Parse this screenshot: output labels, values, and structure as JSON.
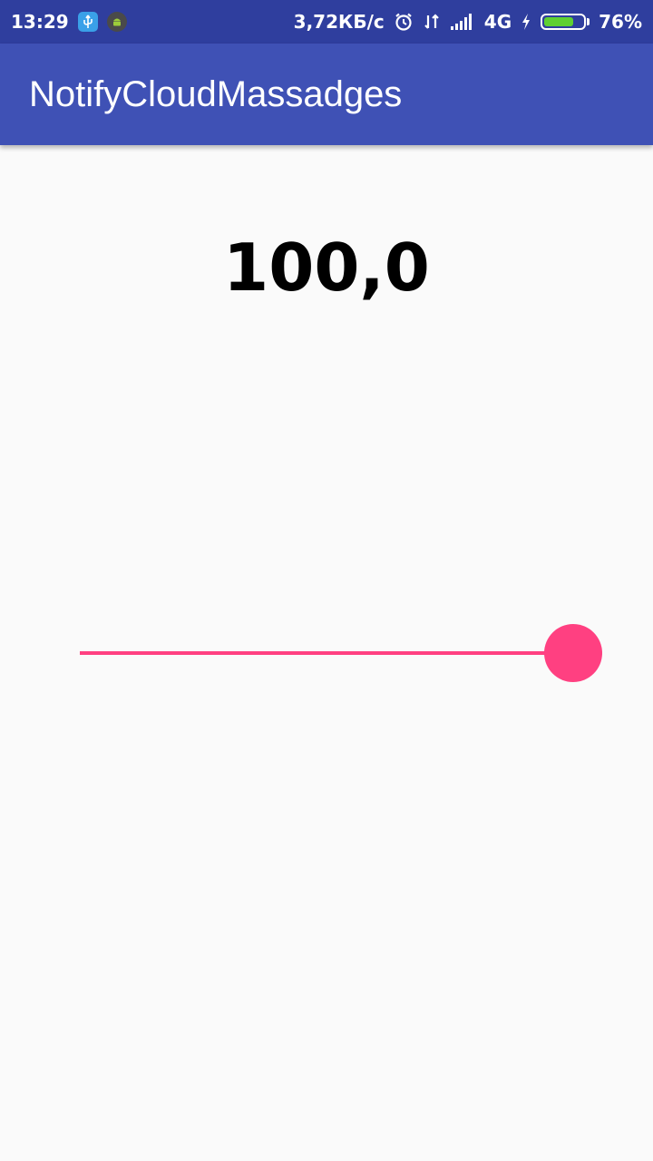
{
  "status_bar": {
    "time": "13:29",
    "net_speed": "3,72КБ/с",
    "network": "4G",
    "battery": "76%",
    "battery_level": 0.76,
    "notification_icons": [
      "usb-icon",
      "android-icon"
    ],
    "status_icons": [
      "alarm-icon",
      "data-transfer-icon",
      "signal-icon",
      "charging-icon",
      "battery-icon"
    ]
  },
  "app_bar": {
    "title": "NotifyCloudMassadges"
  },
  "main": {
    "value": "100,0",
    "slider": {
      "value": 1.0,
      "active_color": "#ff4081",
      "inactive_color": "#bdbdbd"
    }
  },
  "colors": {
    "status_bar": "#2f3e9e",
    "primary": "#3f51b5",
    "accent": "#ff4081",
    "background": "#fafafa"
  }
}
